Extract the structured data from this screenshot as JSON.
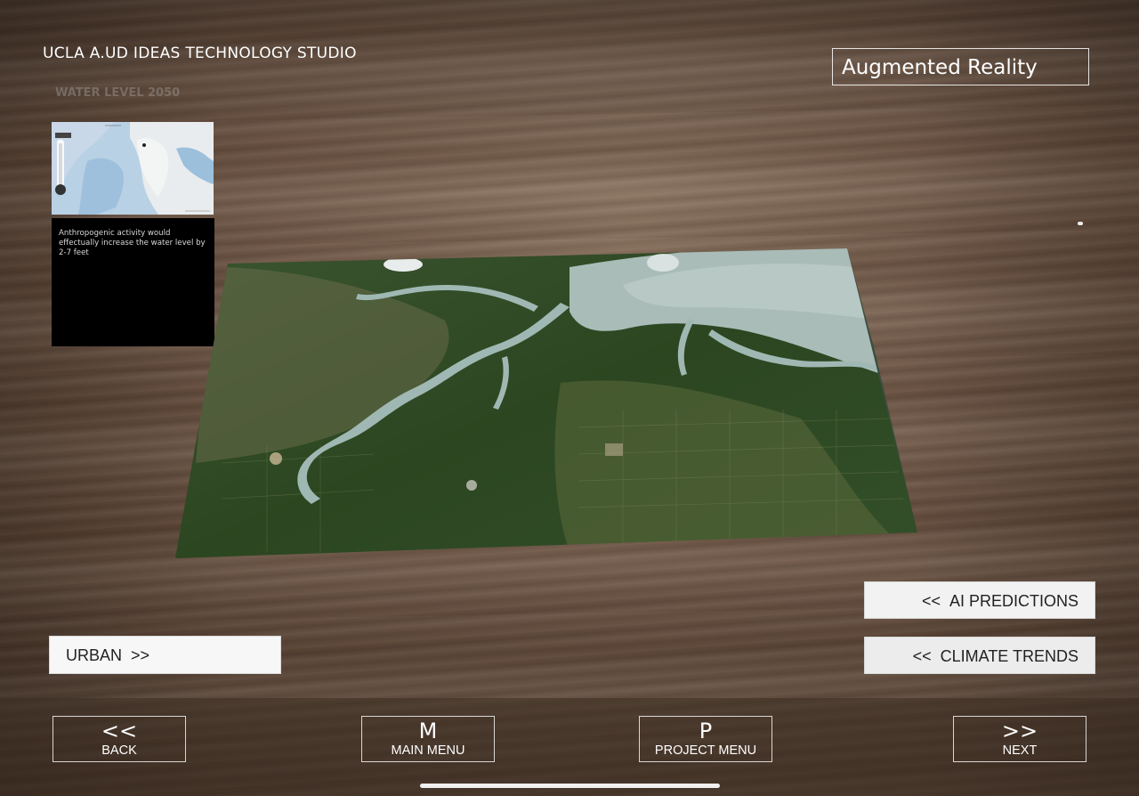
{
  "header": {
    "studio_title": "UCLA A.UD IDEAS TECHNOLOGY STUDIO",
    "mode_badge": "Augmented Reality"
  },
  "overlay": {
    "ghost_label": "WATER LEVEL ",
    "ghost_value": "2050"
  },
  "info_panel": {
    "text": "Anthropogenic activity would effectually increase the water level by 2-7 feet"
  },
  "ar_model": {
    "subject": "satellite-terrain-map",
    "colors": {
      "vegetation": "#2f4a22",
      "river": "#9fb8b3",
      "estuary": "#a9bcb8"
    }
  },
  "buttons": {
    "urban": {
      "label": "URBAN",
      "chevron": ">>"
    },
    "ai_predictions": {
      "label": "AI PREDICTIONS",
      "chevron": "<<"
    },
    "climate_trends": {
      "label": "CLIMATE TRENDS",
      "chevron": "<<"
    }
  },
  "nav": {
    "back": {
      "glyph": "<<",
      "label": "BACK"
    },
    "main_menu": {
      "glyph": "M",
      "label": "MAIN MENU"
    },
    "project_menu": {
      "glyph": "P",
      "label": "PROJECT MENU"
    },
    "next": {
      "glyph": ">>",
      "label": "NEXT"
    }
  },
  "colors": {
    "panel_bg": "#000000",
    "button_bg": "#f2f2f2",
    "border_light": "#ffffff"
  }
}
